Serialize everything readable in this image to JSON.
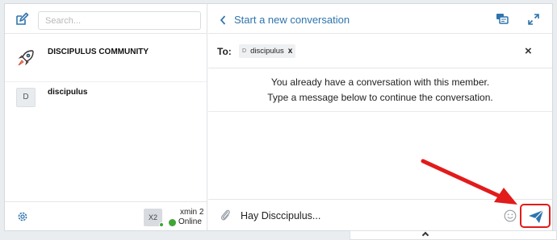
{
  "search": {
    "placeholder": "Search..."
  },
  "conversations": [
    {
      "name": "DISCIPULUS COMMUNITY",
      "avatar_icon": "rocket-icon"
    },
    {
      "name": "discipulus",
      "avatar_initial": "D"
    }
  ],
  "me": {
    "avatar_text": "X2",
    "name": "xmin 2",
    "status": "Online",
    "status_color": "#3fa535"
  },
  "header": {
    "title": "Start a new conversation"
  },
  "recipients": {
    "label": "To:",
    "chips": [
      {
        "initial": "D",
        "name": "discipulus",
        "remove": "x"
      }
    ],
    "close": "×"
  },
  "notice": {
    "line1": "You already have a conversation with this member.",
    "line2": "Type a message below to continue the conversation."
  },
  "composer": {
    "value": "Hay Disccipulus..."
  },
  "colors": {
    "accent": "#2f74ad",
    "highlight": "#e21b1b"
  }
}
